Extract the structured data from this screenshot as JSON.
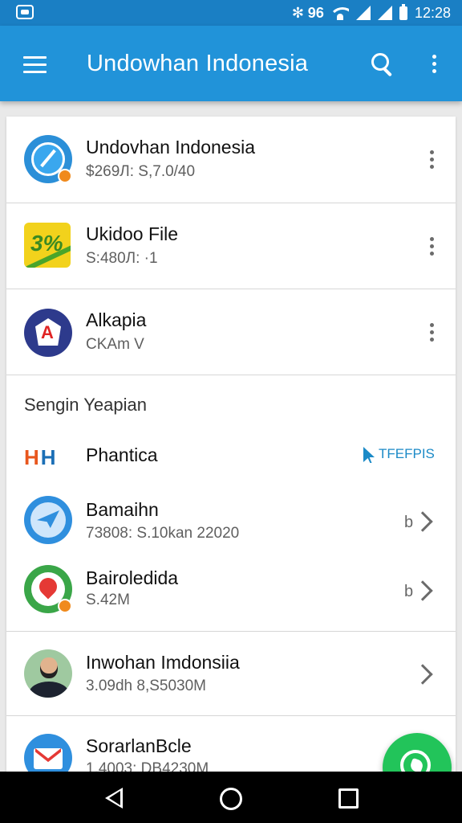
{
  "status_bar": {
    "signal_text": "✻ 𝟗𝟔",
    "time": "12:28"
  },
  "app_bar": {
    "title": "Undowhan Indonesia"
  },
  "items": [
    {
      "title": "Undovhan Indonesia",
      "subtitle": "$269Л: S,7.0/40",
      "icon": "safari-compass-icon"
    },
    {
      "title": "Ukidoo File",
      "subtitle": "S:480Л: ·1",
      "icon": "file-app-icon"
    },
    {
      "title": "Alkapia",
      "subtitle": "CKAm  V",
      "icon": "alkapia-shield-icon"
    }
  ],
  "section": {
    "heading": "Sengin Yeapian",
    "brand": {
      "letters": [
        "H",
        "H"
      ],
      "label": "Phantica",
      "link": "TFEFPIS"
    },
    "items": [
      {
        "title": "Bamaihn",
        "subtitle": "73808: S.10kan 22020",
        "trail": "b"
      },
      {
        "title": "Bairoledida",
        "subtitle": "S.42M",
        "trail": "b"
      }
    ]
  },
  "more_items": [
    {
      "title": "Inwohan Imdonsiia",
      "subtitle": "3.09dh 8,S5030M"
    },
    {
      "title": "SorarlanBcle",
      "subtitle": "1.4003: DB4230M"
    }
  ]
}
